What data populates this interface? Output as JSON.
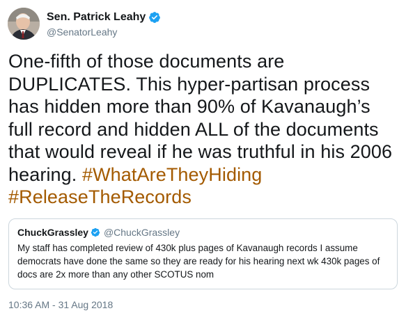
{
  "author": {
    "display_name": "Sen. Patrick Leahy",
    "handle": "@SenatorLeahy",
    "avatar_icon": "avatar-photo",
    "verified_icon": "verified-badge-icon",
    "verified_color": "#1da1f2"
  },
  "tweet": {
    "text_plain": "One-fifth of those documents are DUPLICATES. This hyper-partisan process has hidden more than 90% of Kavanaugh’s full record and hidden ALL of the documents that would reveal if he was truthful in his 2006 hearing.",
    "hashtags": [
      "#WhatAreTheyHiding",
      "#ReleaseTheRecords"
    ],
    "hashtag_color": "#a35a00"
  },
  "quoted_tweet": {
    "display_name": "ChuckGrassley",
    "handle": "@ChuckGrassley",
    "text": "My staff has completed review of 430k plus pages of Kavanaugh records I assume democrats have done the same so they are ready for his hearing next wk 430k pages of docs are 2x more than any other SCOTUS nom"
  },
  "timestamp": "10:36 AM - 31 Aug 2018"
}
